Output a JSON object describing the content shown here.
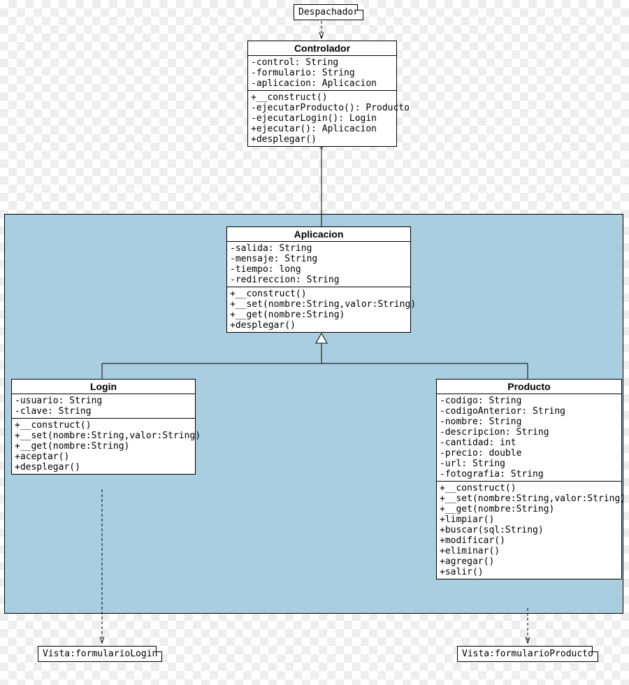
{
  "notes": {
    "despachador": "Despachador",
    "vistaLogin": "Vista:formularioLogin",
    "vistaProducto": "Vista:formularioProducto"
  },
  "classes": {
    "controlador": {
      "name": "Controlador",
      "attrs": [
        "-control: String",
        "-formulario: String",
        "-aplicacion: Aplicacion"
      ],
      "ops": [
        "+__construct()",
        "-ejecutarProducto(): Producto",
        "-ejecutarLogin(): Login",
        "+ejecutar(): Aplicacion",
        "+desplegar()"
      ]
    },
    "aplicacion": {
      "name": "Aplicacion",
      "attrs": [
        "-salida: String",
        "-mensaje: String",
        "-tiempo: long",
        "-redireccion: String"
      ],
      "ops": [
        "+__construct()",
        "+__set(nombre:String,valor:String)",
        "+__get(nombre:String)",
        "+desplegar()"
      ]
    },
    "login": {
      "name": "Login",
      "attrs": [
        "-usuario: String",
        "-clave: String"
      ],
      "ops": [
        "+__construct()",
        "+__set(nombre:String,valor:String)",
        "+__get(nombre:String)",
        "+aceptar()",
        "+desplegar()"
      ]
    },
    "producto": {
      "name": "Producto",
      "attrs": [
        "-codigo: String",
        "-codigoAnterior: String",
        "-nombre: String",
        "-descripcion: String",
        "-cantidad: int",
        "-precio: double",
        "-url: String",
        "-fotografia: String"
      ],
      "ops": [
        "+__construct()",
        "+__set(nombre:String,valor:String)",
        "+__get(nombre:String)",
        "+limpiar()",
        "+buscar(sql:String)",
        "+modificar()",
        "+eliminar()",
        "+agregar()",
        "+salir()"
      ]
    }
  }
}
